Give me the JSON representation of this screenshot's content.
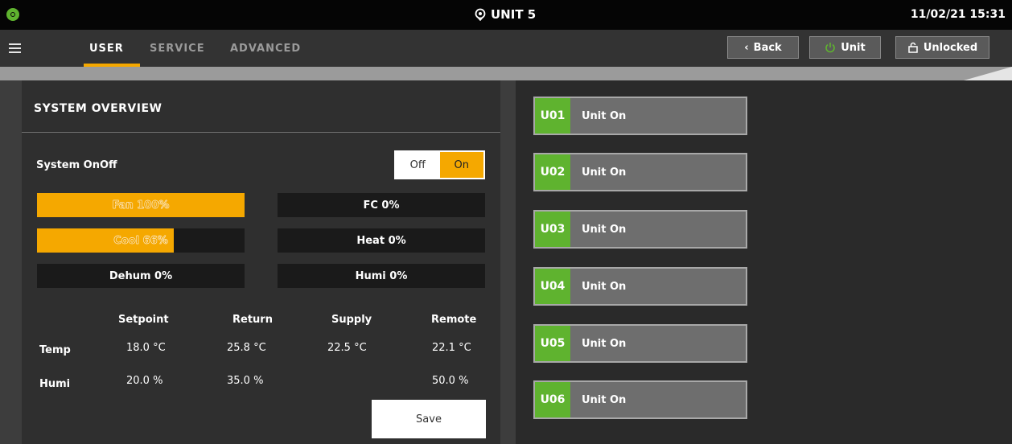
{
  "header": {
    "unit_title": "UNIT 5",
    "datetime": "11/02/21 15:31"
  },
  "nav": {
    "tabs": [
      {
        "label": "USER",
        "active": true
      },
      {
        "label": "SERVICE",
        "active": false
      },
      {
        "label": "ADVANCED",
        "active": false
      }
    ],
    "back_label": "Back",
    "unit_label": "Unit",
    "lock_label": "Unlocked"
  },
  "overview": {
    "title": "SYSTEM OVERVIEW",
    "system_label": "System OnOff",
    "toggle": {
      "off": "Off",
      "on": "On",
      "value": "On"
    },
    "bars": [
      {
        "label": "Fan 100%",
        "fill": 1.0
      },
      {
        "label": "FC 0%",
        "fill": 0.0
      },
      {
        "label": "Cool 66%",
        "fill": 0.66
      },
      {
        "label": "Heat 0%",
        "fill": 0.0
      },
      {
        "label": "Dehum 0%",
        "fill": 0.0
      },
      {
        "label": "Humi 0%",
        "fill": 0.0
      }
    ],
    "table": {
      "headers": [
        "Setpoint",
        "Return",
        "Supply",
        "Remote"
      ],
      "rows": [
        {
          "label": "Temp",
          "values": [
            "18.0 °C",
            "25.8 °C",
            "22.5 °C",
            "22.1 °C"
          ]
        },
        {
          "label": "Humi",
          "values": [
            "20.0 %",
            "35.0 %",
            "",
            "50.0 %"
          ]
        }
      ]
    },
    "save_label": "Save"
  },
  "units": [
    {
      "id": "U01",
      "status": "Unit On"
    },
    {
      "id": "U02",
      "status": "Unit On"
    },
    {
      "id": "U03",
      "status": "Unit On"
    },
    {
      "id": "U04",
      "status": "Unit On"
    },
    {
      "id": "U05",
      "status": "Unit On"
    },
    {
      "id": "U06",
      "status": "Unit On"
    }
  ],
  "colors": {
    "accent": "#f5a800",
    "unit_green": "#5fb32f",
    "panel": "#2f2f2f"
  }
}
